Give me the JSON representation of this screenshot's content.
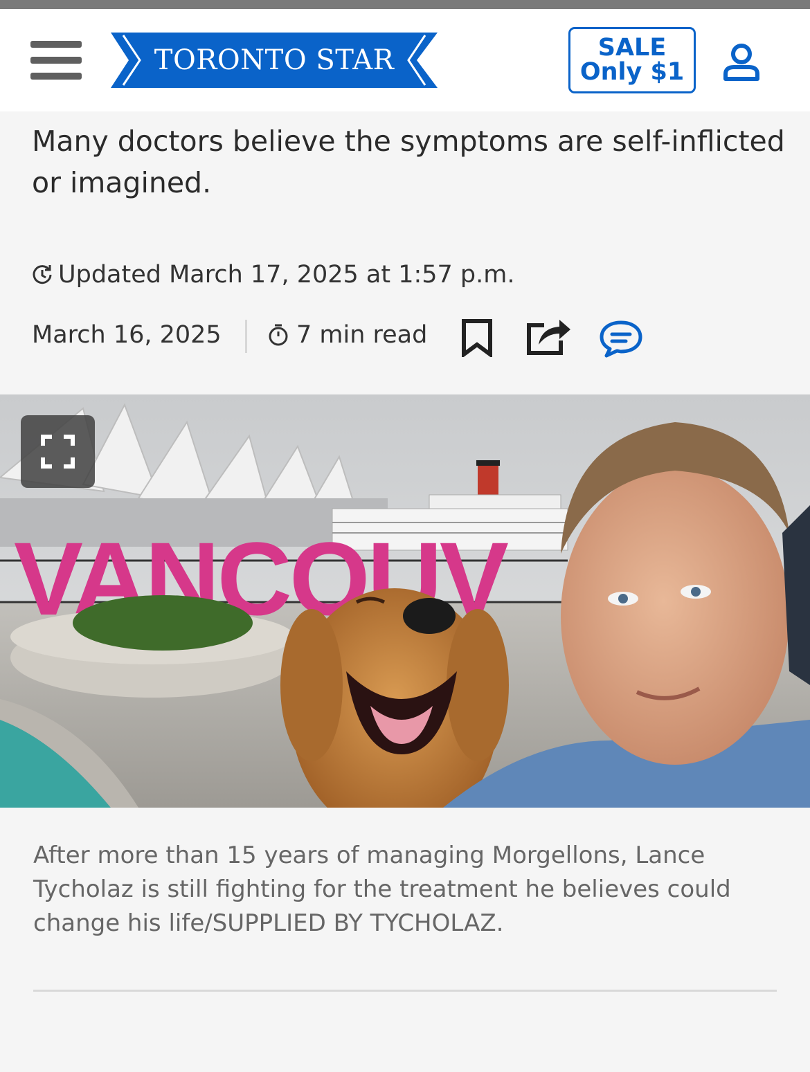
{
  "header": {
    "menu_icon": "hamburger-menu-icon",
    "logo_text": "TORONTO STAR",
    "brand_color": "#0a63c9",
    "sale": {
      "line1": "SALE",
      "line2": "Only $1"
    },
    "account_icon": "user-icon"
  },
  "article": {
    "subheadline": "Many doctors believe the symptoms are self-inflicted or imagined.",
    "updated": "Updated March 17, 2025 at 1:57 p.m.",
    "date": "March 16, 2025",
    "read_time": "7 min read",
    "actions": {
      "bookmark_icon": "bookmark-icon",
      "share_icon": "share-icon",
      "comment_icon": "comment-icon"
    },
    "image": {
      "sign_text": "VANCOUV",
      "expand_icon": "fullscreen-icon"
    },
    "caption": "After more than 15 years of managing Morgellons, Lance Tycholaz is still fighting for the treatment he believes could change his life/SUPPLIED BY TYCHOLAZ."
  }
}
